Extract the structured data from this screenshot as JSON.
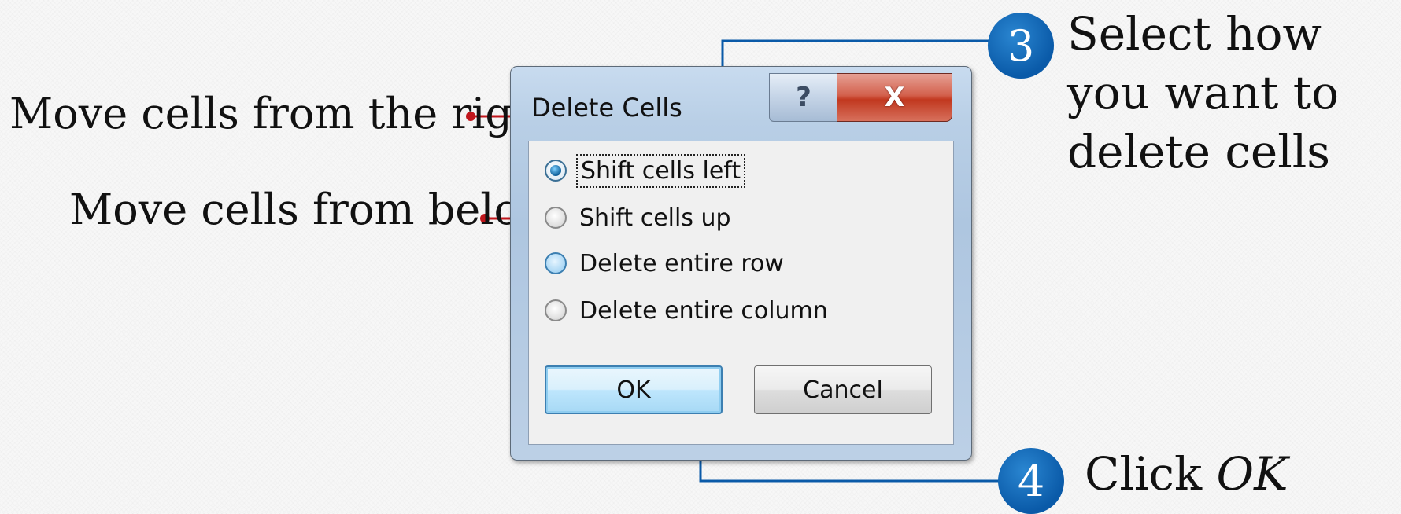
{
  "annotations": {
    "move_right": "Move cells from the right",
    "move_below": "Move cells from below",
    "step3": {
      "number": "3",
      "text": "Select how you want to delete cells"
    },
    "step4": {
      "number": "4",
      "text_prefix": "Click ",
      "text_emph": "OK"
    }
  },
  "dialog": {
    "title": "Delete Cells",
    "help_label": "?",
    "close_label": "X",
    "options": [
      {
        "label": "Shift cells left",
        "checked": true
      },
      {
        "label": "Shift cells up",
        "checked": false
      },
      {
        "label": "Delete entire row",
        "checked": false
      },
      {
        "label": "Delete entire column",
        "checked": false
      }
    ],
    "ok_label": "OK",
    "cancel_label": "Cancel"
  },
  "colors": {
    "callout_red": "#c0161c",
    "callout_blue": "#0a5aa8"
  },
  "icons": [
    "help-icon",
    "close-icon"
  ]
}
